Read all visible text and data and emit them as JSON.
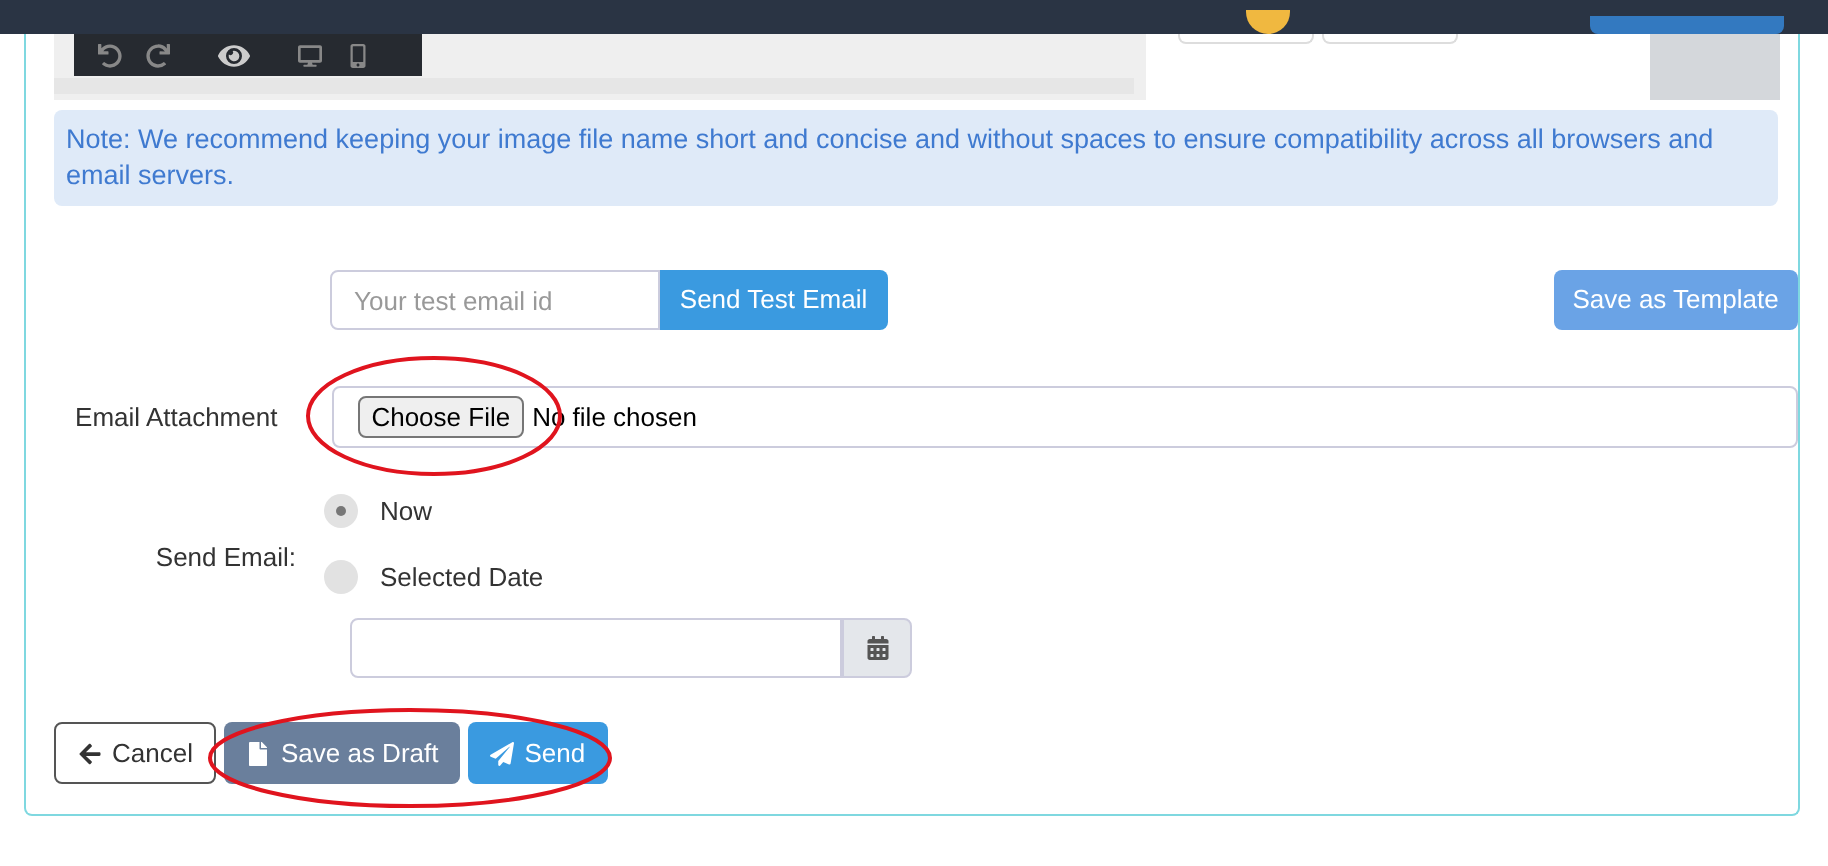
{
  "note": "Note: We recommend keeping your image file name short and concise and without spaces to ensure compatibility across all browsers and email servers.",
  "test_email": {
    "placeholder": "Your test email id",
    "button": "Send Test Email"
  },
  "save_template": "Save as Template",
  "attachment": {
    "label": "Email Attachment",
    "button": "Choose File",
    "status": "No file chosen"
  },
  "send_email": {
    "label": "Send Email:",
    "options": [
      {
        "label": "Now",
        "selected": true
      },
      {
        "label": "Selected Date",
        "selected": false
      }
    ]
  },
  "actions": [
    {
      "kind": "cancel",
      "label": "Cancel"
    },
    {
      "kind": "draft",
      "label": "Save as Draft"
    },
    {
      "kind": "send",
      "label": "Send"
    }
  ]
}
